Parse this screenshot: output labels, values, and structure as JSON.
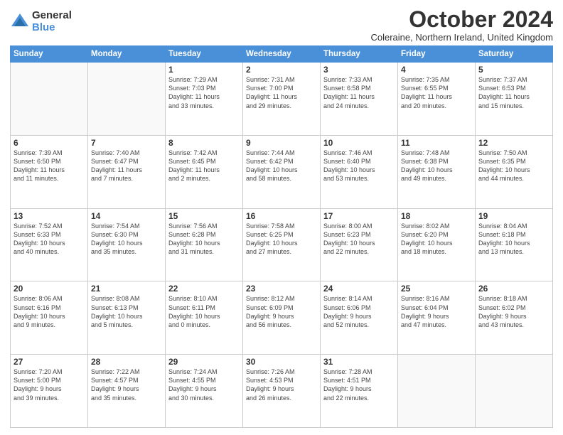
{
  "header": {
    "logo_general": "General",
    "logo_blue": "Blue",
    "month_title": "October 2024",
    "location": "Coleraine, Northern Ireland, United Kingdom"
  },
  "days_of_week": [
    "Sunday",
    "Monday",
    "Tuesday",
    "Wednesday",
    "Thursday",
    "Friday",
    "Saturday"
  ],
  "weeks": [
    [
      {
        "day": "",
        "info": ""
      },
      {
        "day": "",
        "info": ""
      },
      {
        "day": "1",
        "info": "Sunrise: 7:29 AM\nSunset: 7:03 PM\nDaylight: 11 hours\nand 33 minutes."
      },
      {
        "day": "2",
        "info": "Sunrise: 7:31 AM\nSunset: 7:00 PM\nDaylight: 11 hours\nand 29 minutes."
      },
      {
        "day": "3",
        "info": "Sunrise: 7:33 AM\nSunset: 6:58 PM\nDaylight: 11 hours\nand 24 minutes."
      },
      {
        "day": "4",
        "info": "Sunrise: 7:35 AM\nSunset: 6:55 PM\nDaylight: 11 hours\nand 20 minutes."
      },
      {
        "day": "5",
        "info": "Sunrise: 7:37 AM\nSunset: 6:53 PM\nDaylight: 11 hours\nand 15 minutes."
      }
    ],
    [
      {
        "day": "6",
        "info": "Sunrise: 7:39 AM\nSunset: 6:50 PM\nDaylight: 11 hours\nand 11 minutes."
      },
      {
        "day": "7",
        "info": "Sunrise: 7:40 AM\nSunset: 6:47 PM\nDaylight: 11 hours\nand 7 minutes."
      },
      {
        "day": "8",
        "info": "Sunrise: 7:42 AM\nSunset: 6:45 PM\nDaylight: 11 hours\nand 2 minutes."
      },
      {
        "day": "9",
        "info": "Sunrise: 7:44 AM\nSunset: 6:42 PM\nDaylight: 10 hours\nand 58 minutes."
      },
      {
        "day": "10",
        "info": "Sunrise: 7:46 AM\nSunset: 6:40 PM\nDaylight: 10 hours\nand 53 minutes."
      },
      {
        "day": "11",
        "info": "Sunrise: 7:48 AM\nSunset: 6:38 PM\nDaylight: 10 hours\nand 49 minutes."
      },
      {
        "day": "12",
        "info": "Sunrise: 7:50 AM\nSunset: 6:35 PM\nDaylight: 10 hours\nand 44 minutes."
      }
    ],
    [
      {
        "day": "13",
        "info": "Sunrise: 7:52 AM\nSunset: 6:33 PM\nDaylight: 10 hours\nand 40 minutes."
      },
      {
        "day": "14",
        "info": "Sunrise: 7:54 AM\nSunset: 6:30 PM\nDaylight: 10 hours\nand 35 minutes."
      },
      {
        "day": "15",
        "info": "Sunrise: 7:56 AM\nSunset: 6:28 PM\nDaylight: 10 hours\nand 31 minutes."
      },
      {
        "day": "16",
        "info": "Sunrise: 7:58 AM\nSunset: 6:25 PM\nDaylight: 10 hours\nand 27 minutes."
      },
      {
        "day": "17",
        "info": "Sunrise: 8:00 AM\nSunset: 6:23 PM\nDaylight: 10 hours\nand 22 minutes."
      },
      {
        "day": "18",
        "info": "Sunrise: 8:02 AM\nSunset: 6:20 PM\nDaylight: 10 hours\nand 18 minutes."
      },
      {
        "day": "19",
        "info": "Sunrise: 8:04 AM\nSunset: 6:18 PM\nDaylight: 10 hours\nand 13 minutes."
      }
    ],
    [
      {
        "day": "20",
        "info": "Sunrise: 8:06 AM\nSunset: 6:16 PM\nDaylight: 10 hours\nand 9 minutes."
      },
      {
        "day": "21",
        "info": "Sunrise: 8:08 AM\nSunset: 6:13 PM\nDaylight: 10 hours\nand 5 minutes."
      },
      {
        "day": "22",
        "info": "Sunrise: 8:10 AM\nSunset: 6:11 PM\nDaylight: 10 hours\nand 0 minutes."
      },
      {
        "day": "23",
        "info": "Sunrise: 8:12 AM\nSunset: 6:09 PM\nDaylight: 9 hours\nand 56 minutes."
      },
      {
        "day": "24",
        "info": "Sunrise: 8:14 AM\nSunset: 6:06 PM\nDaylight: 9 hours\nand 52 minutes."
      },
      {
        "day": "25",
        "info": "Sunrise: 8:16 AM\nSunset: 6:04 PM\nDaylight: 9 hours\nand 47 minutes."
      },
      {
        "day": "26",
        "info": "Sunrise: 8:18 AM\nSunset: 6:02 PM\nDaylight: 9 hours\nand 43 minutes."
      }
    ],
    [
      {
        "day": "27",
        "info": "Sunrise: 7:20 AM\nSunset: 5:00 PM\nDaylight: 9 hours\nand 39 minutes."
      },
      {
        "day": "28",
        "info": "Sunrise: 7:22 AM\nSunset: 4:57 PM\nDaylight: 9 hours\nand 35 minutes."
      },
      {
        "day": "29",
        "info": "Sunrise: 7:24 AM\nSunset: 4:55 PM\nDaylight: 9 hours\nand 30 minutes."
      },
      {
        "day": "30",
        "info": "Sunrise: 7:26 AM\nSunset: 4:53 PM\nDaylight: 9 hours\nand 26 minutes."
      },
      {
        "day": "31",
        "info": "Sunrise: 7:28 AM\nSunset: 4:51 PM\nDaylight: 9 hours\nand 22 minutes."
      },
      {
        "day": "",
        "info": ""
      },
      {
        "day": "",
        "info": ""
      }
    ]
  ]
}
